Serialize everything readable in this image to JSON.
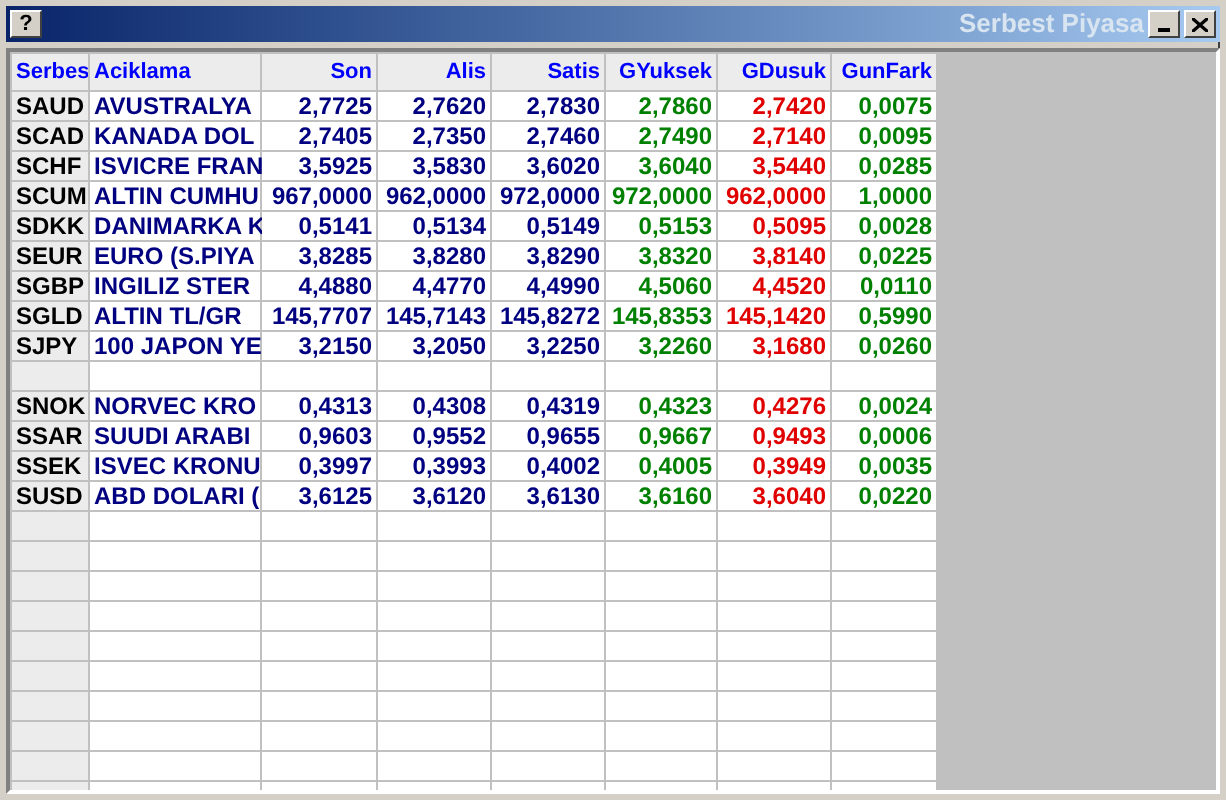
{
  "window": {
    "title": "Serbest Piyasa",
    "help_button": "?"
  },
  "columns": [
    {
      "label": "Serbes",
      "kind": "code"
    },
    {
      "label": "Aciklama",
      "kind": "text"
    },
    {
      "label": "Son",
      "kind": "number"
    },
    {
      "label": "Alis",
      "kind": "number"
    },
    {
      "label": "Satis",
      "kind": "number"
    },
    {
      "label": "GYuksek",
      "kind": "high"
    },
    {
      "label": "GDusuk",
      "kind": "low"
    },
    {
      "label": "GunFark",
      "kind": "high"
    }
  ],
  "rows": [
    {
      "kind": "data",
      "cells": [
        "SAUD",
        "AVUSTRALYA",
        "2,7725",
        "2,7620",
        "2,7830",
        "2,7860",
        "2,7420",
        "0,0075"
      ]
    },
    {
      "kind": "data",
      "cells": [
        "SCAD",
        "KANADA DOL",
        "2,7405",
        "2,7350",
        "2,7460",
        "2,7490",
        "2,7140",
        "0,0095"
      ]
    },
    {
      "kind": "data",
      "cells": [
        "SCHF",
        "ISVICRE FRAN",
        "3,5925",
        "3,5830",
        "3,6020",
        "3,6040",
        "3,5440",
        "0,0285"
      ]
    },
    {
      "kind": "data",
      "cells": [
        "SCUM",
        "ALTIN CUMHU",
        "967,0000",
        "962,0000",
        "972,0000",
        "972,0000",
        "962,0000",
        "1,0000"
      ]
    },
    {
      "kind": "data",
      "cells": [
        "SDKK",
        "DANIMARKA K",
        "0,5141",
        "0,5134",
        "0,5149",
        "0,5153",
        "0,5095",
        "0,0028"
      ]
    },
    {
      "kind": "data",
      "cells": [
        "SEUR",
        "EURO (S.PIYA",
        "3,8285",
        "3,8280",
        "3,8290",
        "3,8320",
        "3,8140",
        "0,0225"
      ]
    },
    {
      "kind": "data",
      "cells": [
        "SGBP",
        "INGILIZ STER",
        "4,4880",
        "4,4770",
        "4,4990",
        "4,5060",
        "4,4520",
        "0,0110"
      ]
    },
    {
      "kind": "data",
      "cells": [
        "SGLD",
        "ALTIN TL/GR",
        "145,7707",
        "145,7143",
        "145,8272",
        "145,8353",
        "145,1420",
        "0,5990"
      ]
    },
    {
      "kind": "data",
      "cells": [
        "SJPY",
        "100 JAPON YE",
        "3,2150",
        "3,2050",
        "3,2250",
        "3,2260",
        "3,1680",
        "0,0260"
      ]
    },
    {
      "kind": "blank"
    },
    {
      "kind": "data",
      "cells": [
        "SNOK",
        "NORVEC KRO",
        "0,4313",
        "0,4308",
        "0,4319",
        "0,4323",
        "0,4276",
        "0,0024"
      ]
    },
    {
      "kind": "data",
      "cells": [
        "SSAR",
        "SUUDI ARABI",
        "0,9603",
        "0,9552",
        "0,9655",
        "0,9667",
        "0,9493",
        "0,0006"
      ]
    },
    {
      "kind": "data",
      "cells": [
        "SSEK",
        "ISVEC KRONU",
        "0,3997",
        "0,3993",
        "0,4002",
        "0,4005",
        "0,3949",
        "0,0035"
      ]
    },
    {
      "kind": "data",
      "cells": [
        "SUSD",
        "ABD DOLARI (",
        "3,6125",
        "3,6120",
        "3,6130",
        "3,6160",
        "3,6040",
        "0,0220"
      ]
    }
  ]
}
